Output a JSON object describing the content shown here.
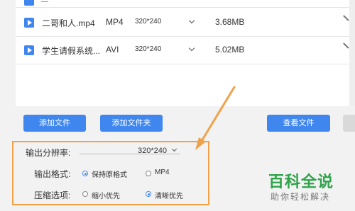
{
  "files": [
    {
      "name": "二哥和人.mp4",
      "format": "MP4",
      "resolution": "320*240",
      "size": "3.68MB"
    },
    {
      "name": "学生请假系统...",
      "format": "AVI",
      "resolution": "320*240",
      "size": "5.02MB"
    }
  ],
  "buttons": {
    "add_file": "添加文件",
    "add_folder": "添加文件夹",
    "view_file": "查看文件"
  },
  "settings": {
    "resolution_label": "输出分辨率:",
    "resolution_value": "320*240",
    "format_label": "输出格式:",
    "format_options": [
      "保持原格式",
      "MP4"
    ],
    "format_selected": "保持原格式",
    "compress_label": "压缩选项:",
    "compress_options": [
      "缩小优先",
      "清晰优先"
    ],
    "compress_selected": "清晰优先"
  },
  "watermark": {
    "title": "百科全说",
    "subtitle": "助你轻松解决"
  },
  "colors": {
    "accent": "#3f87ee",
    "highlight_box": "#f0a24b",
    "watermark_green": "#2ea34a"
  },
  "icons": [
    "play-icon",
    "chevron-down-icon",
    "radio-button",
    "arrow-annotation"
  ]
}
